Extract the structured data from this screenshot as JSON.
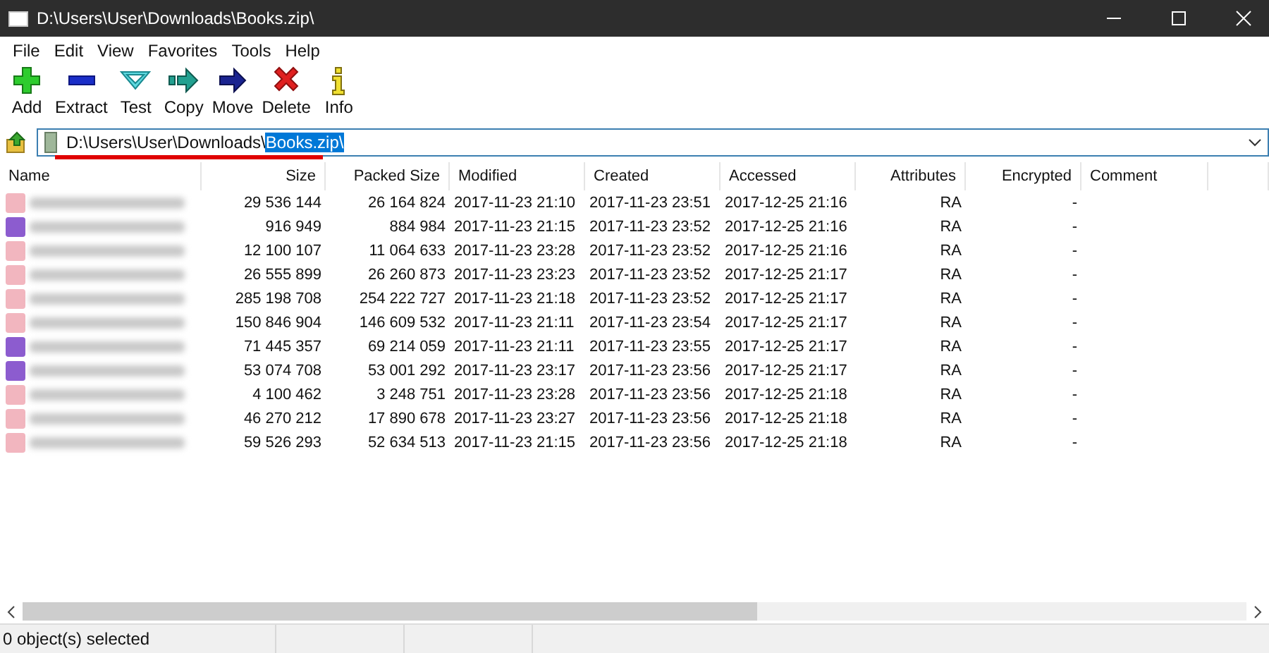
{
  "window": {
    "title": "D:\\Users\\User\\Downloads\\Books.zip\\"
  },
  "menu": [
    "File",
    "Edit",
    "View",
    "Favorites",
    "Tools",
    "Help"
  ],
  "toolbar": [
    {
      "kind": "add",
      "label": "Add"
    },
    {
      "kind": "extract",
      "label": "Extract"
    },
    {
      "kind": "test",
      "label": "Test"
    },
    {
      "kind": "copy",
      "label": "Copy"
    },
    {
      "kind": "move",
      "label": "Move"
    },
    {
      "kind": "delete",
      "label": "Delete"
    },
    {
      "kind": "info",
      "label": "Info"
    }
  ],
  "address": {
    "prefix": "D:\\Users\\User\\Downloads\\",
    "selected_part": "Books.zip\\"
  },
  "table": {
    "columns": [
      "Name",
      "Size",
      "Packed Size",
      "Modified",
      "Created",
      "Accessed",
      "Attributes",
      "Encrypted",
      "Comment"
    ],
    "rows": [
      {
        "color": "#f2b6bf",
        "size": "29 536 144",
        "packed": "26 164 824",
        "modified": "2017-11-23 21:10",
        "created": "2017-11-23 23:51",
        "accessed": "2017-12-25 21:16",
        "attributes": "RA",
        "encrypted": "-"
      },
      {
        "color": "#8c5ccf",
        "size": "916 949",
        "packed": "884 984",
        "modified": "2017-11-23 21:15",
        "created": "2017-11-23 23:52",
        "accessed": "2017-12-25 21:16",
        "attributes": "RA",
        "encrypted": "-"
      },
      {
        "color": "#f2b6bf",
        "size": "12 100 107",
        "packed": "11 064 633",
        "modified": "2017-11-23 23:28",
        "created": "2017-11-23 23:52",
        "accessed": "2017-12-25 21:16",
        "attributes": "RA",
        "encrypted": "-"
      },
      {
        "color": "#f2b6bf",
        "size": "26 555 899",
        "packed": "26 260 873",
        "modified": "2017-11-23 23:23",
        "created": "2017-11-23 23:52",
        "accessed": "2017-12-25 21:17",
        "attributes": "RA",
        "encrypted": "-"
      },
      {
        "color": "#f2b6bf",
        "size": "285 198 708",
        "packed": "254 222 727",
        "modified": "2017-11-23 21:18",
        "created": "2017-11-23 23:52",
        "accessed": "2017-12-25 21:17",
        "attributes": "RA",
        "encrypted": "-"
      },
      {
        "color": "#f2b6bf",
        "size": "150 846 904",
        "packed": "146 609 532",
        "modified": "2017-11-23 21:11",
        "created": "2017-11-23 23:54",
        "accessed": "2017-12-25 21:17",
        "attributes": "RA",
        "encrypted": "-"
      },
      {
        "color": "#8c5ccf",
        "size": "71 445 357",
        "packed": "69 214 059",
        "modified": "2017-11-23 21:11",
        "created": "2017-11-23 23:55",
        "accessed": "2017-12-25 21:17",
        "attributes": "RA",
        "encrypted": "-"
      },
      {
        "color": "#8c5ccf",
        "size": "53 074 708",
        "packed": "53 001 292",
        "modified": "2017-11-23 23:17",
        "created": "2017-11-23 23:56",
        "accessed": "2017-12-25 21:17",
        "attributes": "RA",
        "encrypted": "-"
      },
      {
        "color": "#f2b6bf",
        "size": "4 100 462",
        "packed": "3 248 751",
        "modified": "2017-11-23 23:28",
        "created": "2017-11-23 23:56",
        "accessed": "2017-12-25 21:18",
        "attributes": "RA",
        "encrypted": "-"
      },
      {
        "color": "#f2b6bf",
        "size": "46 270 212",
        "packed": "17 890 678",
        "modified": "2017-11-23 23:27",
        "created": "2017-11-23 23:56",
        "accessed": "2017-12-25 21:18",
        "attributes": "RA",
        "encrypted": "-"
      },
      {
        "color": "#f2b6bf",
        "size": "59 526 293",
        "packed": "52 634 513",
        "modified": "2017-11-23 21:15",
        "created": "2017-11-23 23:56",
        "accessed": "2017-12-25 21:18",
        "attributes": "RA",
        "encrypted": "-"
      }
    ]
  },
  "status_bar": {
    "text": "0 object(s) selected"
  }
}
